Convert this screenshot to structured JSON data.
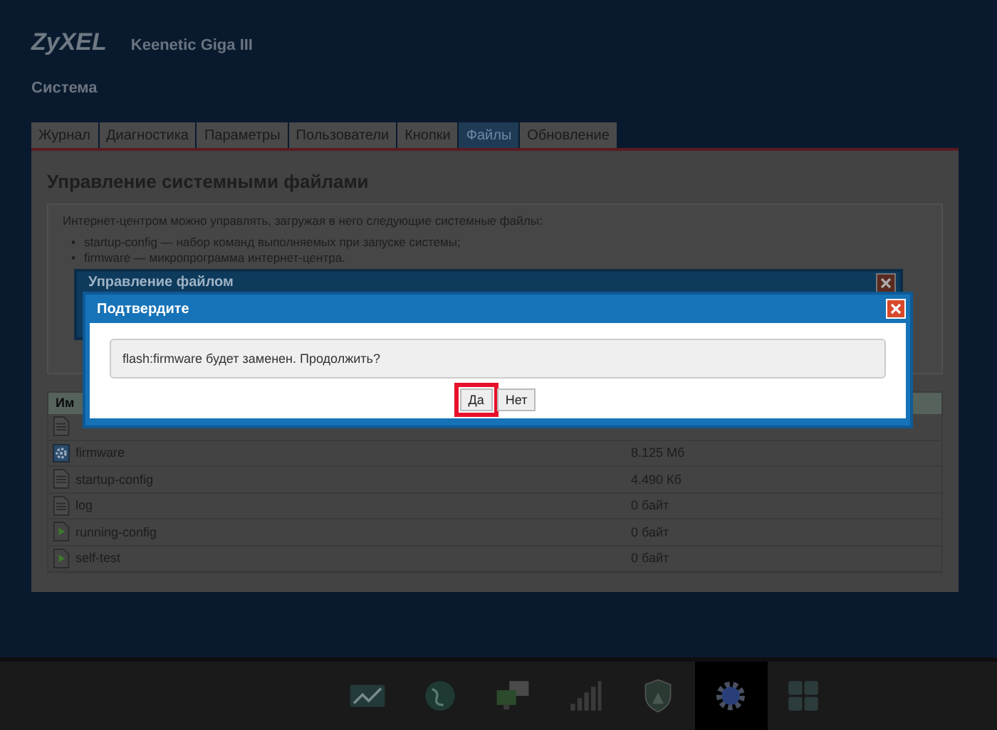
{
  "header": {
    "brand": "ZyXEL",
    "model": "Keenetic Giga III",
    "section": "Система"
  },
  "tabs": [
    {
      "label": "Журнал",
      "selected": false
    },
    {
      "label": "Диагностика",
      "selected": false
    },
    {
      "label": "Параметры",
      "selected": false
    },
    {
      "label": "Пользователи",
      "selected": false
    },
    {
      "label": "Кнопки",
      "selected": false
    },
    {
      "label": "Файлы",
      "selected": true
    },
    {
      "label": "Обновление",
      "selected": false
    }
  ],
  "panel": {
    "heading": "Управление системными файлами",
    "intro": "Интернет-центром можно управлять, загружая в него следующие системные файлы:",
    "bullets": [
      {
        "marker": "•",
        "text": "startup-config — набор команд выполняемых при запуске системы;"
      },
      {
        "marker": "•",
        "text": "firmware — микропрограмма интернет-центра."
      }
    ]
  },
  "table": {
    "header": "Им",
    "rows": [
      {
        "kind": "doc"
      },
      {
        "kind": "gear",
        "name": "firmware",
        "size": "8.125 Мб"
      },
      {
        "kind": "doc",
        "name": "startup-config",
        "size": "4.490 Кб"
      },
      {
        "kind": "doc",
        "name": "log",
        "size": "0 байт"
      },
      {
        "kind": "play",
        "name": "running-config",
        "size": "0 байт"
      },
      {
        "kind": "play",
        "name": "self-test",
        "size": "0 байт"
      }
    ]
  },
  "back_dialog": {
    "title": "Управление файлом"
  },
  "confirm_dialog": {
    "title": "Подтвердите",
    "message": "flash:firmware будет заменен. Продолжить?",
    "buttons": [
      {
        "label": "Да",
        "highlighted": true
      },
      {
        "label": "Нет",
        "highlighted": false
      }
    ]
  },
  "taskbar": [
    {
      "kind": "chart",
      "selected": false
    },
    {
      "kind": "globe",
      "selected": false
    },
    {
      "kind": "network",
      "selected": false
    },
    {
      "kind": "signal",
      "selected": false
    },
    {
      "kind": "shield",
      "selected": false
    },
    {
      "kind": "gear",
      "selected": true
    },
    {
      "kind": "apps",
      "selected": false
    }
  ]
}
